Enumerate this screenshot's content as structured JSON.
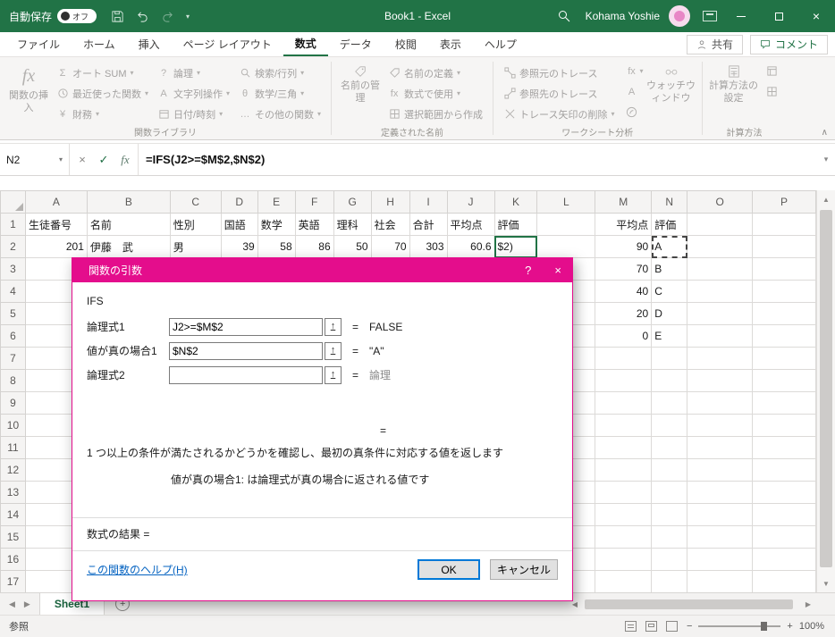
{
  "icons": {
    "dropdown": "▾",
    "close": "×",
    "help": "?",
    "enter": "✓",
    "cancel": "×",
    "fx": "fx",
    "sigma": "Σ",
    "question": "?",
    "letterA": "A",
    "theta": "θ",
    "dots": "…",
    "yen": "¥",
    "plus": "+",
    "left": "◀",
    "right": "▶",
    "up": "▲",
    "down": "▼",
    "collapse": "∧",
    "select_range": "↑",
    "minus": "−",
    "plus_zoom": "+"
  },
  "titlebar": {
    "autosave_label": "自動保存",
    "autosave_state": "オフ",
    "title": "Book1 - Excel",
    "user": "Kohama Yoshie"
  },
  "ribbon": {
    "tabs": [
      {
        "label": "ファイル"
      },
      {
        "label": "ホーム"
      },
      {
        "label": "挿入"
      },
      {
        "label": "ページ レイアウト"
      },
      {
        "label": "数式"
      },
      {
        "label": "データ"
      },
      {
        "label": "校閲"
      },
      {
        "label": "表示"
      },
      {
        "label": "ヘルプ"
      }
    ],
    "share": "共有",
    "comments": "コメント",
    "insert_function": "関数の挿入",
    "library": {
      "caption": "関数ライブラリ",
      "autosum": "オート SUM",
      "recent": "最近使った関数",
      "financial": "財務",
      "logical": "論理",
      "text": "文字列操作",
      "datetime": "日付/時刻",
      "lookup": "検索/行列",
      "math": "数学/三角",
      "more": "その他の関数"
    },
    "names": {
      "caption": "定義された名前",
      "manager": "名前の管理",
      "define": "名前の定義",
      "use_in_formula": "数式で使用",
      "create_from_selection": "選択範囲から作成"
    },
    "auditing": {
      "caption": "ワークシート分析",
      "trace_precedents": "参照元のトレース",
      "trace_dependents": "参照先のトレース",
      "remove_arrows": "トレース矢印の削除",
      "watch": "ウォッチウィンドウ"
    },
    "calc": {
      "caption": "計算方法",
      "options": "計算方法の設定"
    }
  },
  "formula_bar": {
    "name_box": "N2",
    "formula": "=IFS(J2>=$M$2,$N$2)"
  },
  "grid": {
    "col_letters": [
      "A",
      "B",
      "C",
      "D",
      "E",
      "F",
      "G",
      "H",
      "I",
      "J",
      "K",
      "L",
      "M",
      "N",
      "O",
      "P"
    ],
    "row_first": 1,
    "row_last": 17,
    "selection": {
      "cols": [
        "K",
        "N"
      ],
      "rows": [
        "2"
      ]
    },
    "cells": {
      "A1": {
        "v": "生徒番号",
        "cls": "hdr"
      },
      "B1": {
        "v": "名前",
        "cls": "hdr"
      },
      "C1": {
        "v": "性別",
        "cls": "hdr"
      },
      "D1": {
        "v": "国語",
        "cls": "hdr"
      },
      "E1": {
        "v": "数学",
        "cls": "hdr"
      },
      "F1": {
        "v": "英語",
        "cls": "hdr"
      },
      "G1": {
        "v": "理科",
        "cls": "hdr"
      },
      "H1": {
        "v": "社会",
        "cls": "hdr"
      },
      "I1": {
        "v": "合計",
        "cls": "hdr"
      },
      "J1": {
        "v": "平均点",
        "cls": "hdr"
      },
      "K1": {
        "v": "評価",
        "cls": "hdr"
      },
      "M1": {
        "v": "平均点",
        "cls": "hdr num"
      },
      "N1": {
        "v": "評価",
        "cls": "hdr"
      },
      "A2": {
        "v": "201",
        "cls": "num"
      },
      "B2": {
        "v": "伊藤　武",
        "cls": ""
      },
      "C2": {
        "v": "男",
        "cls": ""
      },
      "D2": {
        "v": "39",
        "cls": "num"
      },
      "E2": {
        "v": "58",
        "cls": "num"
      },
      "F2": {
        "v": "86",
        "cls": "num"
      },
      "G2": {
        "v": "50",
        "cls": "num"
      },
      "H2": {
        "v": "70",
        "cls": "num"
      },
      "I2": {
        "v": "303",
        "cls": "num"
      },
      "J2": {
        "v": "60.6",
        "cls": "num"
      },
      "K2": {
        "v": "$2)",
        "cls": "editcell"
      },
      "M2": {
        "v": "90",
        "cls": "num"
      },
      "N2": {
        "v": "A",
        "cls": "ants"
      },
      "M3": {
        "v": "70",
        "cls": "num"
      },
      "N3": {
        "v": "B",
        "cls": ""
      },
      "M4": {
        "v": "40",
        "cls": "num"
      },
      "N4": {
        "v": "C",
        "cls": ""
      },
      "M5": {
        "v": "20",
        "cls": "num"
      },
      "N5": {
        "v": "D",
        "cls": ""
      },
      "M6": {
        "v": "0",
        "cls": "num"
      },
      "N6": {
        "v": "E",
        "cls": ""
      }
    }
  },
  "dialog": {
    "title": "関数の引数",
    "function_name": "IFS",
    "equals": "=",
    "args": [
      {
        "label": "論理式1",
        "value": "J2>=$M$2",
        "result": "FALSE"
      },
      {
        "label": "値が真の場合1",
        "value": "$N$2",
        "result": "\"A\""
      },
      {
        "label": "論理式2",
        "value": "",
        "result": "論理"
      }
    ],
    "description": "1 つ以上の条件が満たされるかどうかを確認し、最初の真条件に対応する値を返します",
    "arg_help": "値が真の場合1:  は論理式が真の場合に返される値です",
    "result_label": "数式の結果 =",
    "help_link": "この関数のヘルプ(H)",
    "ok": "OK",
    "cancel": "キャンセル"
  },
  "sheet_tabs": {
    "active": "Sheet1"
  },
  "status_bar": {
    "mode": "参照",
    "zoom": "100%"
  }
}
